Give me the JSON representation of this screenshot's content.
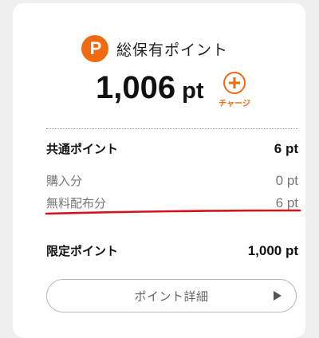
{
  "summary": {
    "title": "総保有ポイント",
    "total_value": "1,006",
    "unit": "pt",
    "charge_label": "チャージ",
    "icons": {
      "logo": "points-logo-icon",
      "charge": "plus-circle-icon"
    },
    "accent_color": "#f06a12"
  },
  "common": {
    "label": "共通ポイント",
    "value": "6 pt",
    "breakdown": [
      {
        "label": "購入分",
        "value": "0 pt"
      },
      {
        "label": "無料配布分",
        "value": "6 pt"
      }
    ]
  },
  "limited": {
    "label": "限定ポイント",
    "value": "1,000 pt"
  },
  "detail_button": {
    "label": "ポイント詳細",
    "icon": "play-arrow-icon"
  }
}
